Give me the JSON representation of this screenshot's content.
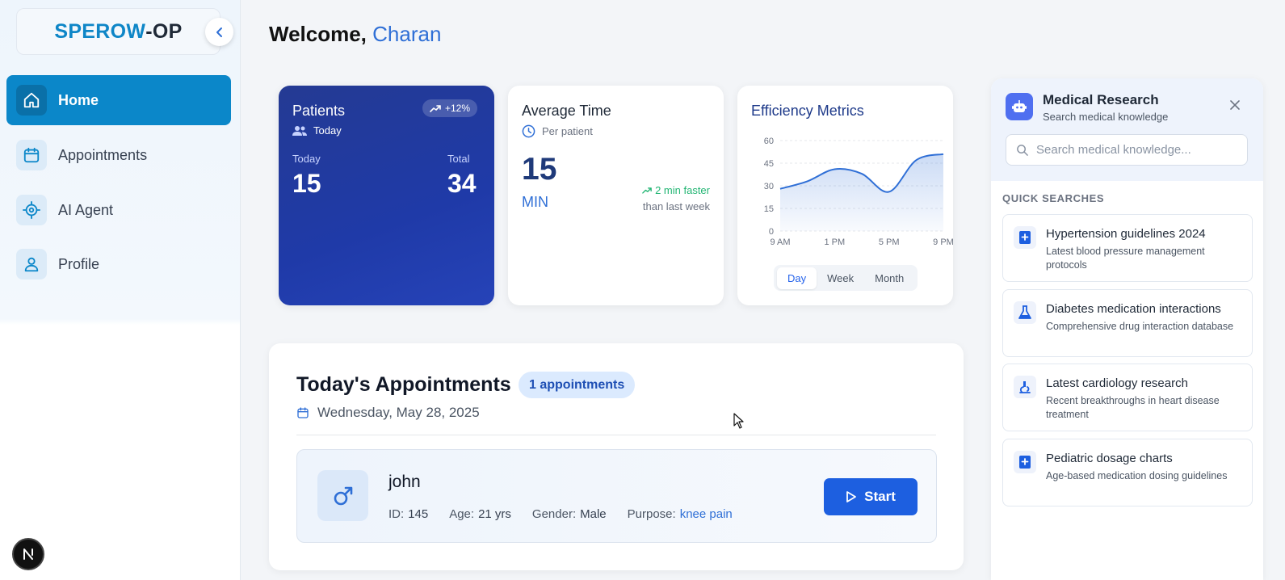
{
  "sidebar": {
    "logo_part_a": "SPEROW",
    "logo_part_b": "-OP",
    "items": [
      {
        "label": "Home",
        "icon": "home-icon",
        "active": true
      },
      {
        "label": "Appointments",
        "icon": "calendar-icon"
      },
      {
        "label": "AI Agent",
        "icon": "target-icon"
      },
      {
        "label": "Profile",
        "icon": "user-icon"
      }
    ]
  },
  "header": {
    "welcome": "Welcome, ",
    "name": "Charan"
  },
  "patients_card": {
    "title": "Patients",
    "trend": "+12%",
    "subtitle": "Today",
    "today_label": "Today",
    "today_value": "15",
    "total_label": "Total",
    "total_value": "34"
  },
  "avg_card": {
    "title": "Average Time",
    "subtitle": "Per patient",
    "value": "15",
    "unit": "MIN",
    "faster": "2 min faster",
    "comparison": "than last week"
  },
  "efficiency_card": {
    "title": "Efficiency Metrics",
    "tabs": [
      "Day",
      "Week",
      "Month"
    ],
    "active_tab": "Day"
  },
  "chart_data": {
    "type": "area",
    "x": [
      "9 AM",
      "11 AM",
      "1 PM",
      "3 PM",
      "5 PM",
      "7 PM",
      "9 PM"
    ],
    "x_tick_labels": [
      "9 AM",
      "1 PM",
      "5 PM",
      "9 PM"
    ],
    "values": [
      28,
      33,
      41,
      38,
      26,
      47,
      51
    ],
    "y_ticks": [
      0,
      15,
      30,
      45,
      60
    ],
    "ylim": [
      0,
      60
    ],
    "grid": true,
    "color": "#2f6fd6"
  },
  "appointments": {
    "title": "Today's Appointments",
    "count_label": "1 appointments",
    "date": "Wednesday, May 28, 2025",
    "rows": [
      {
        "name": "john",
        "id_label": "ID:",
        "id": "145",
        "age_label": "Age:",
        "age": "21 yrs",
        "gender_label": "Gender:",
        "gender": "Male",
        "purpose_label": "Purpose:",
        "purpose": "knee pain",
        "action": "Start"
      }
    ]
  },
  "research": {
    "title": "Medical Research",
    "subtitle": "Search medical knowledge",
    "search_placeholder": "Search medical knowledge...",
    "quick_label": "QUICK SEARCHES",
    "items": [
      {
        "title": "Hypertension guidelines 2024",
        "desc": "Latest blood pressure management protocols",
        "icon": "book-plus-icon"
      },
      {
        "title": "Diabetes medication interactions",
        "desc": "Comprehensive drug interaction database",
        "icon": "flask-icon"
      },
      {
        "title": "Latest cardiology research",
        "desc": "Recent breakthroughs in heart disease treatment",
        "icon": "microscope-icon"
      },
      {
        "title": "Pediatric dosage charts",
        "desc": "Age-based medication dosing guidelines",
        "icon": "book-plus-icon"
      }
    ]
  },
  "colors": {
    "brand": "#0b87c9",
    "accent": "#2f6fd6",
    "primary_button": "#1d5fe0",
    "patients_card": "#1f3aa8",
    "success": "#22b573"
  }
}
